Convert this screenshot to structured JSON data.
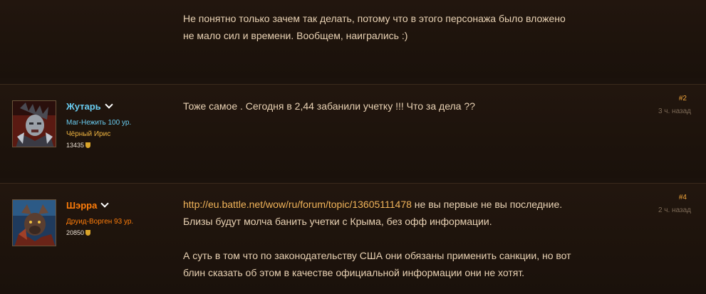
{
  "posts": [
    {
      "body": [
        "Не понятно только зачем так делать, потому что в этого персонажа было вложено",
        "не мало сил и времени. Вообщем, наигрались :)"
      ]
    },
    {
      "author": "Жутарь",
      "class_level": "Маг-Нежить 100 ур.",
      "guild": "Чёрный Ирис",
      "points": "13435",
      "post_number": "#2",
      "time": "3 ч. назад",
      "name_color": "#69ccf0",
      "class_color": "#69ccf0",
      "body": [
        "Тоже самое . Сегодня в 2,44 забанили учетку !!! Что за дела ??"
      ]
    },
    {
      "author": "Шэрра",
      "class_level": "Друид-Ворген 93 ур.",
      "points": "20850",
      "post_number": "#4",
      "time": "2 ч. назад",
      "name_color": "#ff7d0a",
      "class_color": "#ff7d0a",
      "link": "http://eu.battle.net/wow/ru/forum/topic/13605111478",
      "line1_rest": " не вы первые не вы последние.",
      "line2": "Близы будут молча банить учетки с Крыма, без офф информации.",
      "para2": [
        "А суть в том что по законодательству США они обязаны применить санкции, но вот",
        "блин сказать об этом в качестве официальной информации они не хотят."
      ]
    }
  ]
}
